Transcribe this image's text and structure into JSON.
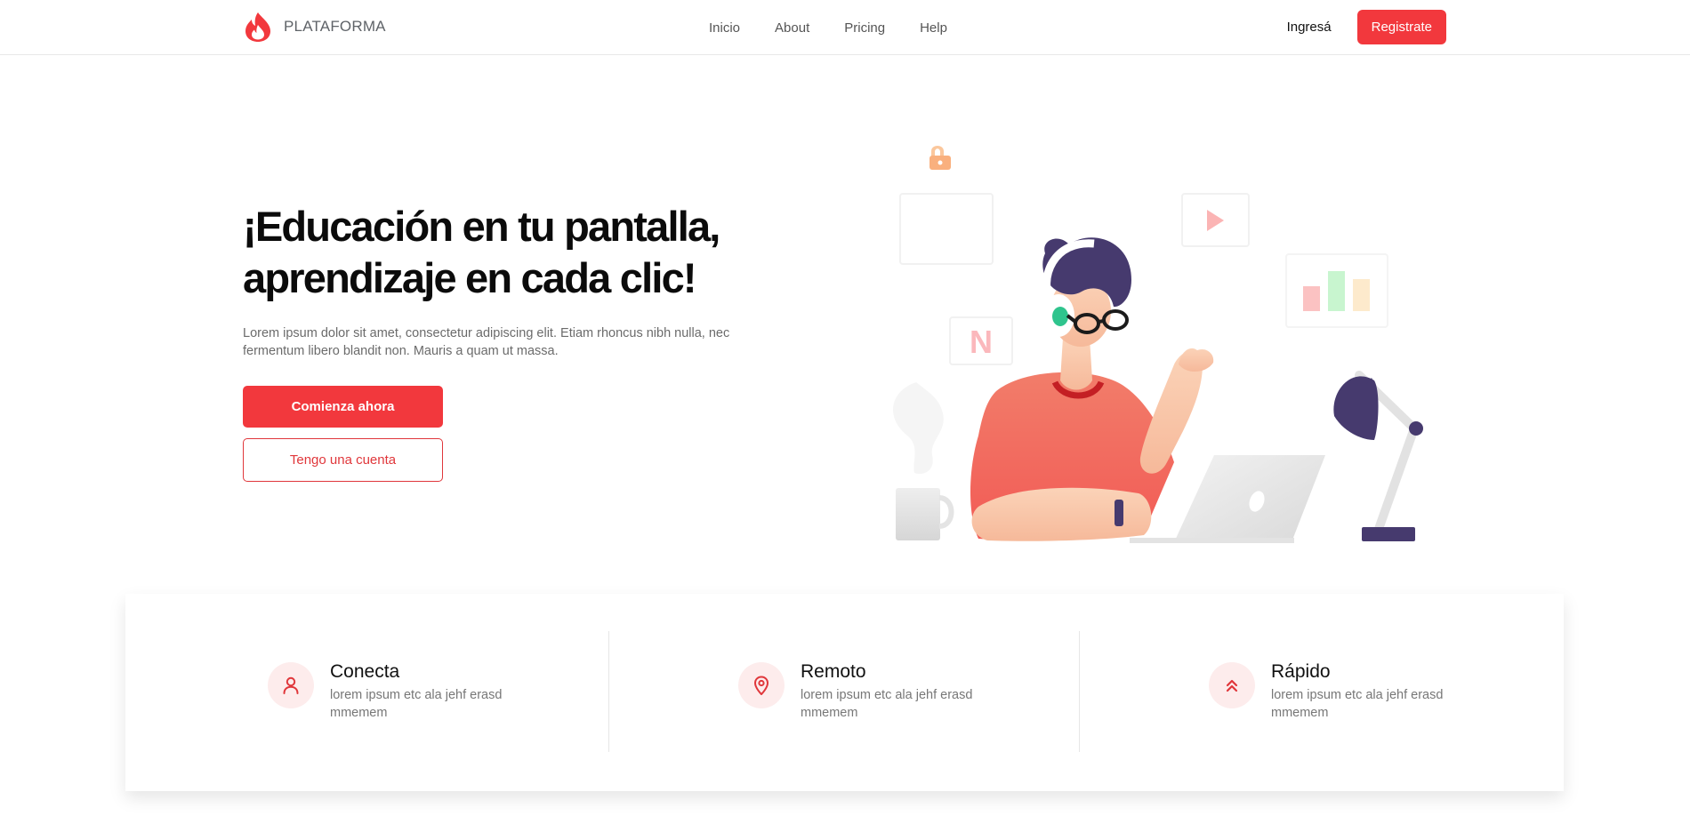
{
  "brand": {
    "name": "PLATAFORMA",
    "icon": "flame-icon",
    "color": "#f2383d"
  },
  "nav": {
    "links": [
      "Inicio",
      "About",
      "Pricing",
      "Help"
    ],
    "login": "Ingresá",
    "register": "Registrate"
  },
  "hero": {
    "title_line1": "¡Educación en tu pantalla,",
    "title_line2": "aprendizaje en cada clic!",
    "description": "Lorem ipsum dolor sit amet, consectetur adipiscing elit. Etiam rhoncus nibh nulla, nec fermentum libero blandit non. Mauris a quam ut massa.",
    "primary_button": "Comienza ahora",
    "secondary_button": "Tengo una cuenta"
  },
  "features": [
    {
      "title": "Conecta",
      "description": "lorem ipsum etc ala jehf erasd mmemem",
      "icon": "user-icon"
    },
    {
      "title": "Remoto",
      "description": "lorem ipsum etc ala jehf erasd mmemem",
      "icon": "location-pin-icon"
    },
    {
      "title": "Rápido",
      "description": "lorem ipsum etc ala jehf erasd mmemem",
      "icon": "double-chevron-up-icon"
    }
  ],
  "illustration": {
    "logo_letter": "N"
  },
  "colors": {
    "accent": "#f2383d",
    "accent_light": "#fdecec",
    "text_muted": "#6b6b6b",
    "navy": "#463a6e"
  }
}
